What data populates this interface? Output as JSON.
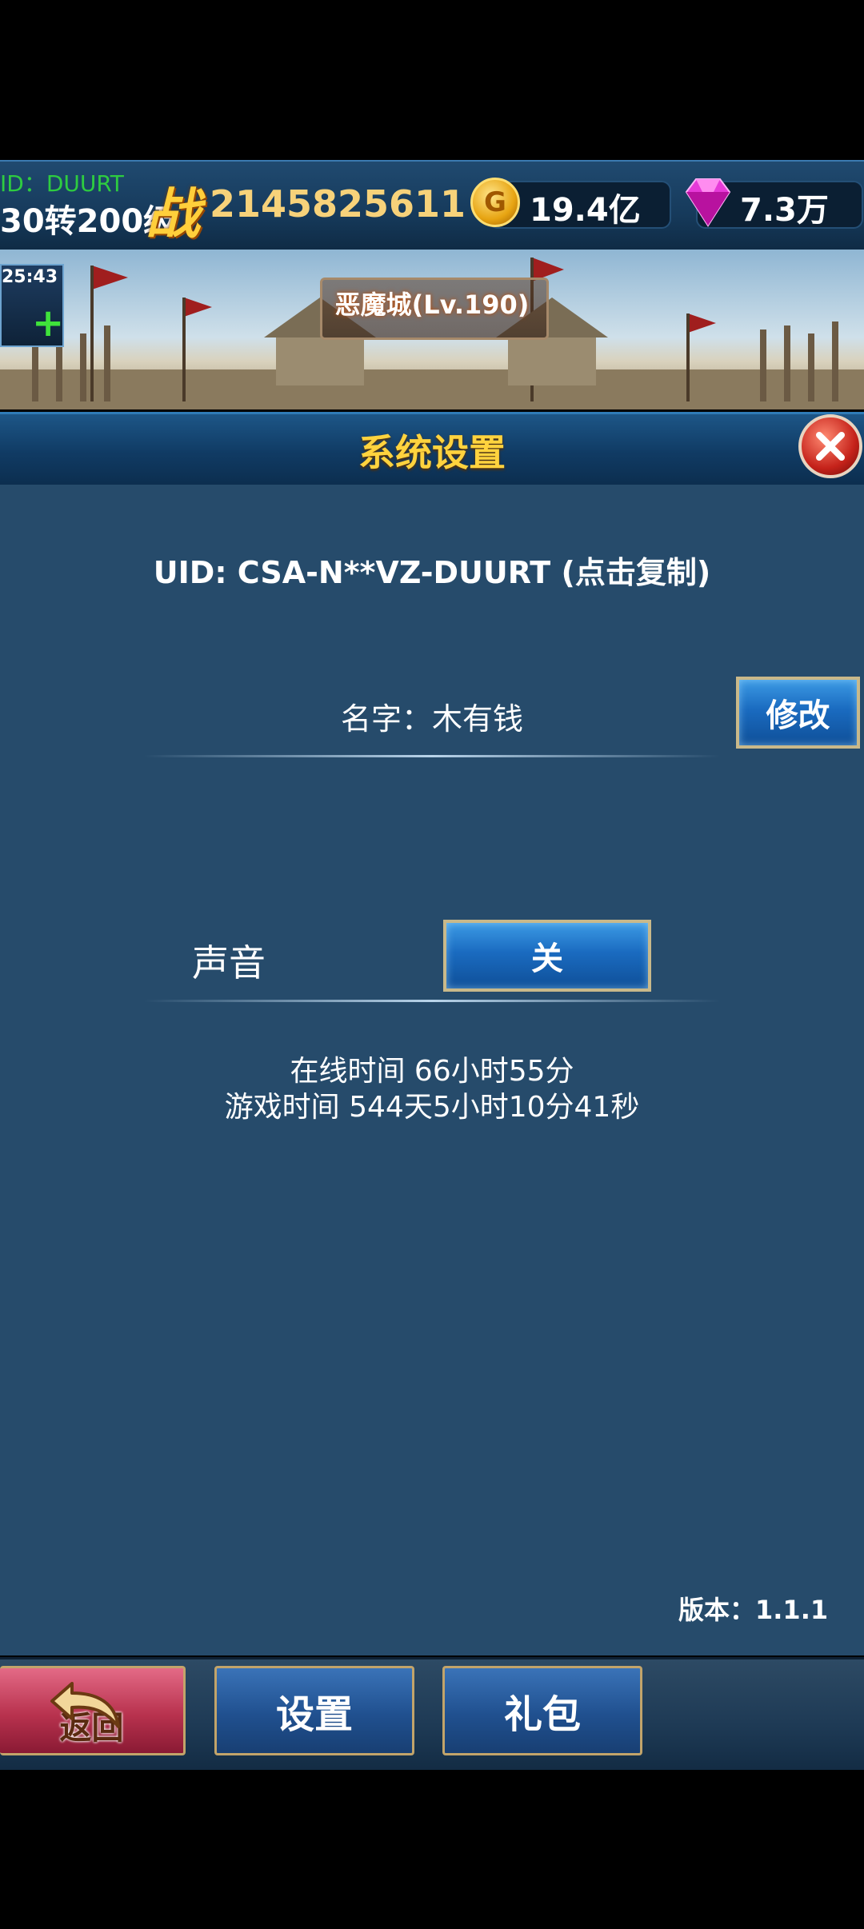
{
  "topbar": {
    "uid_label": "ID：DUURT",
    "rebirth_level": "30转200级",
    "power_icon_text": "战",
    "power_value": "2145825611",
    "gold": {
      "icon": "gold-coin-icon",
      "icon_text": "G",
      "value": "19.4亿"
    },
    "gems": {
      "icon": "diamond-icon",
      "value": "7.3万"
    }
  },
  "banner": {
    "title": "恶魔城(Lv.190)",
    "timer": "25:43",
    "plus_icon": "+"
  },
  "panel": {
    "title": "系统设置",
    "uid_text": "UID: CSA-N**VZ-DUURT (点击复制)",
    "name_text": "名字：木有钱",
    "rename_label": "修改",
    "sound_label": "声音",
    "sound_toggle_label": "关",
    "online_time": "在线时间 66小时55分",
    "play_time": "游戏时间 544天5小时10分41秒",
    "version": "版本：1.1.1"
  },
  "bottom_tabs": {
    "back_label": "返回",
    "settings_label": "设置",
    "gifts_label": "礼包"
  },
  "colors": {
    "panel_bg": "#264b6b",
    "title_gold": "#ffd33e",
    "button_blue": "#1a6bc0",
    "back_red": "#b8324e"
  }
}
